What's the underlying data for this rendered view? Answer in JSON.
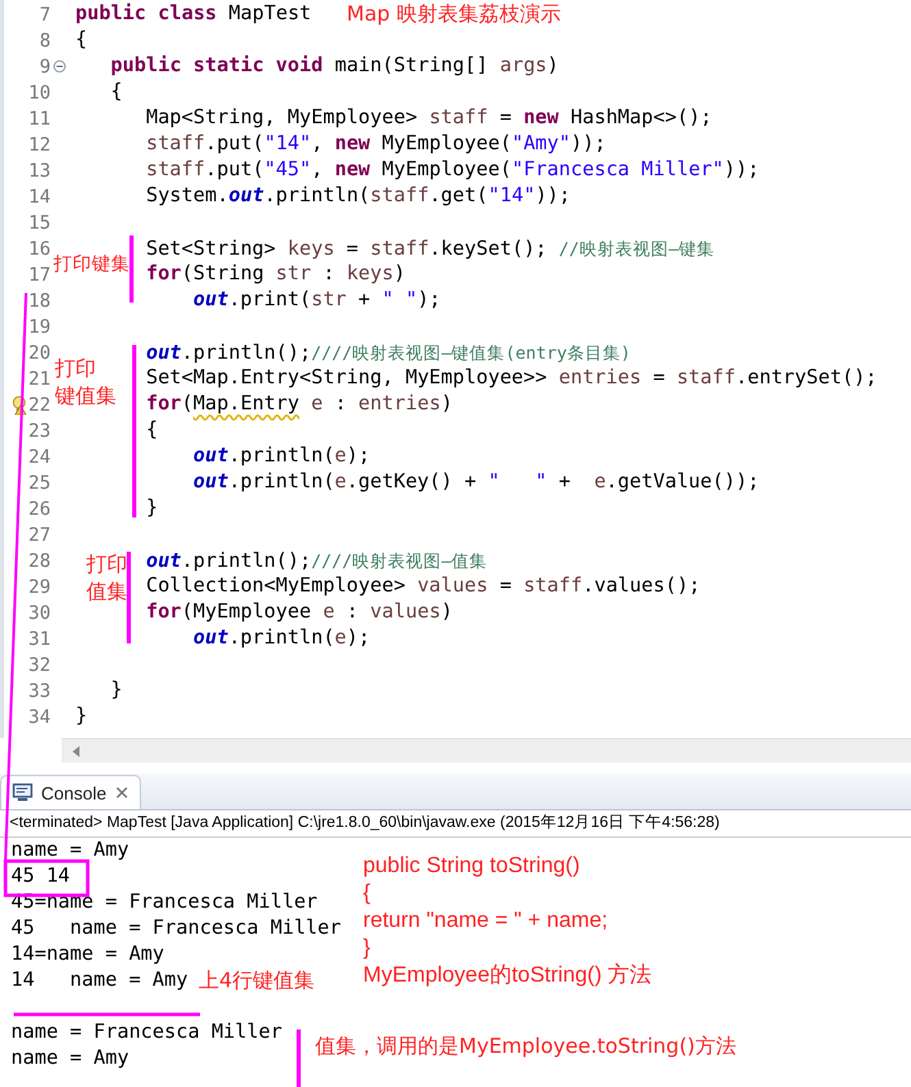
{
  "editor": {
    "lines": [
      {
        "number": "7",
        "segments": [
          {
            "text": "public class",
            "kind": "keyword"
          },
          {
            "text": " MapTest",
            "kind": "plain"
          }
        ]
      },
      {
        "number": "8",
        "segments": [
          {
            "text": "{",
            "kind": "plain"
          }
        ]
      },
      {
        "number": "9",
        "foldable": true,
        "segments": [
          {
            "text": "   public static void",
            "kind": "keyword"
          },
          {
            "text": " main(String[] ",
            "kind": "plain"
          },
          {
            "text": "args",
            "kind": "variable"
          },
          {
            "text": ")",
            "kind": "plain"
          }
        ]
      },
      {
        "number": "10",
        "segments": [
          {
            "text": "   {",
            "kind": "plain"
          }
        ]
      },
      {
        "number": "11",
        "segments": [
          {
            "text": "      Map<String, MyEmployee> ",
            "kind": "plain"
          },
          {
            "text": "staff",
            "kind": "variable"
          },
          {
            "text": " = ",
            "kind": "plain"
          },
          {
            "text": "new",
            "kind": "keyword"
          },
          {
            "text": " HashMap<>();",
            "kind": "plain"
          }
        ]
      },
      {
        "number": "12",
        "segments": [
          {
            "text": "      staff",
            "kind": "variable"
          },
          {
            "text": ".put(",
            "kind": "plain"
          },
          {
            "text": "\"14\"",
            "kind": "string"
          },
          {
            "text": ", ",
            "kind": "plain"
          },
          {
            "text": "new",
            "kind": "keyword"
          },
          {
            "text": " MyEmployee(",
            "kind": "plain"
          },
          {
            "text": "\"Amy\"",
            "kind": "string"
          },
          {
            "text": "));",
            "kind": "plain"
          }
        ]
      },
      {
        "number": "13",
        "segments": [
          {
            "text": "      staff",
            "kind": "variable"
          },
          {
            "text": ".put(",
            "kind": "plain"
          },
          {
            "text": "\"45\"",
            "kind": "string"
          },
          {
            "text": ", ",
            "kind": "plain"
          },
          {
            "text": "new",
            "kind": "keyword"
          },
          {
            "text": " MyEmployee(",
            "kind": "plain"
          },
          {
            "text": "\"Francesca Miller\"",
            "kind": "string"
          },
          {
            "text": "));",
            "kind": "plain"
          }
        ]
      },
      {
        "number": "14",
        "segments": [
          {
            "text": "      System.",
            "kind": "plain"
          },
          {
            "text": "out",
            "kind": "static"
          },
          {
            "text": ".println(",
            "kind": "plain"
          },
          {
            "text": "staff",
            "kind": "variable"
          },
          {
            "text": ".get(",
            "kind": "plain"
          },
          {
            "text": "\"14\"",
            "kind": "string"
          },
          {
            "text": "));",
            "kind": "plain"
          }
        ]
      },
      {
        "number": "15"
      },
      {
        "number": "16",
        "segments": [
          {
            "text": "      Set<String> ",
            "kind": "plain"
          },
          {
            "text": "keys",
            "kind": "variable"
          },
          {
            "text": " = ",
            "kind": "plain"
          },
          {
            "text": "staff",
            "kind": "variable"
          },
          {
            "text": ".keySet(); ",
            "kind": "plain"
          },
          {
            "text": "//映射表视图—键集",
            "kind": "comment"
          }
        ]
      },
      {
        "number": "17",
        "segments": [
          {
            "text": "      for",
            "kind": "keyword"
          },
          {
            "text": "(String ",
            "kind": "plain"
          },
          {
            "text": "str",
            "kind": "variable"
          },
          {
            "text": " : ",
            "kind": "plain"
          },
          {
            "text": "keys",
            "kind": "variable"
          },
          {
            "text": ")",
            "kind": "plain"
          }
        ]
      },
      {
        "number": "18",
        "segments": [
          {
            "text": "          out",
            "kind": "static"
          },
          {
            "text": ".print(",
            "kind": "plain"
          },
          {
            "text": "str",
            "kind": "variable"
          },
          {
            "text": " + ",
            "kind": "plain"
          },
          {
            "text": "\" \"",
            "kind": "string"
          },
          {
            "text": ");",
            "kind": "plain"
          }
        ]
      },
      {
        "number": "19"
      },
      {
        "number": "20",
        "segments": [
          {
            "text": "      out",
            "kind": "static"
          },
          {
            "text": ".println();",
            "kind": "plain"
          },
          {
            "text": "////映射表视图—键值集(entry条目集)",
            "kind": "comment"
          }
        ]
      },
      {
        "number": "21",
        "segments": [
          {
            "text": "      Set<Map.Entry<String, MyEmployee>> ",
            "kind": "plain"
          },
          {
            "text": "entries",
            "kind": "variable"
          },
          {
            "text": " = ",
            "kind": "plain"
          },
          {
            "text": "staff",
            "kind": "variable"
          },
          {
            "text": ".entrySet();",
            "kind": "plain"
          }
        ]
      },
      {
        "number": "22",
        "warning": true,
        "segments": [
          {
            "text": "      for",
            "kind": "keyword"
          },
          {
            "text": "(",
            "kind": "plain"
          },
          {
            "text": "Map.Entry",
            "kind": "warning"
          },
          {
            "text": " e",
            "kind": "variable"
          },
          {
            "text": " : ",
            "kind": "plain"
          },
          {
            "text": "entries",
            "kind": "variable"
          },
          {
            "text": ")",
            "kind": "plain"
          }
        ]
      },
      {
        "number": "23",
        "segments": [
          {
            "text": "      {",
            "kind": "plain"
          }
        ]
      },
      {
        "number": "24",
        "segments": [
          {
            "text": "          out",
            "kind": "static"
          },
          {
            "text": ".println(",
            "kind": "plain"
          },
          {
            "text": "e",
            "kind": "variable"
          },
          {
            "text": ");",
            "kind": "plain"
          }
        ]
      },
      {
        "number": "25",
        "segments": [
          {
            "text": "          out",
            "kind": "static"
          },
          {
            "text": ".println(",
            "kind": "plain"
          },
          {
            "text": "e",
            "kind": "variable"
          },
          {
            "text": ".getKey() + ",
            "kind": "plain"
          },
          {
            "text": "\"   \"",
            "kind": "string"
          },
          {
            "text": " +  ",
            "kind": "plain"
          },
          {
            "text": "e",
            "kind": "variable"
          },
          {
            "text": ".getValue());",
            "kind": "plain"
          }
        ]
      },
      {
        "number": "26",
        "segments": [
          {
            "text": "      }",
            "kind": "plain"
          }
        ]
      },
      {
        "number": "27"
      },
      {
        "number": "28",
        "segments": [
          {
            "text": "      out",
            "kind": "static"
          },
          {
            "text": ".println();",
            "kind": "plain"
          },
          {
            "text": "////映射表视图—值集",
            "kind": "comment"
          }
        ]
      },
      {
        "number": "29",
        "segments": [
          {
            "text": "      Collection<MyEmployee> ",
            "kind": "plain"
          },
          {
            "text": "values",
            "kind": "variable"
          },
          {
            "text": " = ",
            "kind": "plain"
          },
          {
            "text": "staff",
            "kind": "variable"
          },
          {
            "text": ".values();",
            "kind": "plain"
          }
        ]
      },
      {
        "number": "30",
        "segments": [
          {
            "text": "      for",
            "kind": "keyword"
          },
          {
            "text": "(MyEmployee ",
            "kind": "plain"
          },
          {
            "text": "e",
            "kind": "variable"
          },
          {
            "text": " : ",
            "kind": "plain"
          },
          {
            "text": "values",
            "kind": "variable"
          },
          {
            "text": ")",
            "kind": "plain"
          }
        ]
      },
      {
        "number": "31",
        "segments": [
          {
            "text": "          out",
            "kind": "static"
          },
          {
            "text": ".println(",
            "kind": "plain"
          },
          {
            "text": "e",
            "kind": "variable"
          },
          {
            "text": ");",
            "kind": "plain"
          }
        ]
      },
      {
        "number": "32"
      },
      {
        "number": "33",
        "segments": [
          {
            "text": "   }",
            "kind": "plain"
          }
        ]
      },
      {
        "number": "34",
        "segments": [
          {
            "text": "}",
            "kind": "plain"
          }
        ]
      }
    ]
  },
  "console": {
    "tab": "Console",
    "status": "<terminated> MapTest [Java Application] C:\\jre1.8.0_60\\bin\\javaw.exe (2015年12月16日 下午4:56:28)",
    "output_groups": [
      [
        "name = Amy",
        "45 14",
        "45=name = Francesca Miller",
        "45   name = Francesca Miller",
        "14=name = Amy",
        "14   name = Amy"
      ],
      [
        "name = Francesca Miller",
        "name = Amy"
      ]
    ]
  },
  "annotations": {
    "title": "Map 映射表集荔枝演示",
    "keys": [
      "打印键集"
    ],
    "entries": [
      "打印",
      "键值集"
    ],
    "values": [
      "打印",
      "值集"
    ],
    "to_string": [
      "public String toString()",
      "{",
      "return \"name = \" + name;",
      "}",
      "MyEmployee的toString() 方法"
    ],
    "entry_output": "上4行键值集",
    "value_output": "值集，调用的是MyEmployee.toString()方法"
  }
}
